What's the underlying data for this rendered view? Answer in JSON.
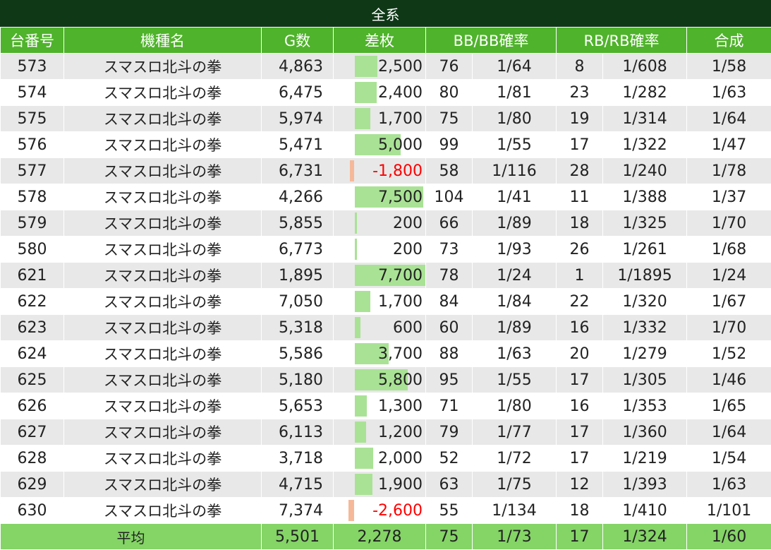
{
  "title": "全系",
  "headers": {
    "unit": "台番号",
    "model": "機種名",
    "games": "G数",
    "diff": "差枚",
    "bb": "BB/BB確率",
    "rb": "RB/RB確率",
    "total": "合成"
  },
  "colors": {
    "title_bg": "#0f3817",
    "header_bg": "#4fb32b",
    "footer_bg": "#84d466",
    "positive_bar": "#a9e295",
    "negative_bar": "#f5b99a",
    "negative_text": "#ff0000"
  },
  "rows": [
    {
      "unit": "573",
      "model": "スマスロ北斗の拳",
      "games": "4,863",
      "diff": "2,500",
      "diff_value": 2500,
      "bb": "76",
      "bb_rate": "1/64",
      "rb": "8",
      "rb_rate": "1/608",
      "total": "1/58"
    },
    {
      "unit": "574",
      "model": "スマスロ北斗の拳",
      "games": "6,475",
      "diff": "2,400",
      "diff_value": 2400,
      "bb": "80",
      "bb_rate": "1/81",
      "rb": "23",
      "rb_rate": "1/282",
      "total": "1/63"
    },
    {
      "unit": "575",
      "model": "スマスロ北斗の拳",
      "games": "5,974",
      "diff": "1,700",
      "diff_value": 1700,
      "bb": "75",
      "bb_rate": "1/80",
      "rb": "19",
      "rb_rate": "1/314",
      "total": "1/64"
    },
    {
      "unit": "576",
      "model": "スマスロ北斗の拳",
      "games": "5,471",
      "diff": "5,000",
      "diff_value": 5000,
      "bb": "99",
      "bb_rate": "1/55",
      "rb": "17",
      "rb_rate": "1/322",
      "total": "1/47"
    },
    {
      "unit": "577",
      "model": "スマスロ北斗の拳",
      "games": "6,731",
      "diff": "-1,800",
      "diff_value": -1800,
      "bb": "58",
      "bb_rate": "1/116",
      "rb": "28",
      "rb_rate": "1/240",
      "total": "1/78"
    },
    {
      "unit": "578",
      "model": "スマスロ北斗の拳",
      "games": "4,266",
      "diff": "7,500",
      "diff_value": 7500,
      "bb": "104",
      "bb_rate": "1/41",
      "rb": "11",
      "rb_rate": "1/388",
      "total": "1/37"
    },
    {
      "unit": "579",
      "model": "スマスロ北斗の拳",
      "games": "5,855",
      "diff": "200",
      "diff_value": 200,
      "bb": "66",
      "bb_rate": "1/89",
      "rb": "18",
      "rb_rate": "1/325",
      "total": "1/70"
    },
    {
      "unit": "580",
      "model": "スマスロ北斗の拳",
      "games": "6,773",
      "diff": "200",
      "diff_value": 200,
      "bb": "73",
      "bb_rate": "1/93",
      "rb": "26",
      "rb_rate": "1/261",
      "total": "1/68"
    },
    {
      "unit": "621",
      "model": "スマスロ北斗の拳",
      "games": "1,895",
      "diff": "7,700",
      "diff_value": 7700,
      "bb": "78",
      "bb_rate": "1/24",
      "rb": "1",
      "rb_rate": "1/1895",
      "total": "1/24"
    },
    {
      "unit": "622",
      "model": "スマスロ北斗の拳",
      "games": "7,050",
      "diff": "1,700",
      "diff_value": 1700,
      "bb": "84",
      "bb_rate": "1/84",
      "rb": "22",
      "rb_rate": "1/320",
      "total": "1/67"
    },
    {
      "unit": "623",
      "model": "スマスロ北斗の拳",
      "games": "5,318",
      "diff": "600",
      "diff_value": 600,
      "bb": "60",
      "bb_rate": "1/89",
      "rb": "16",
      "rb_rate": "1/332",
      "total": "1/70"
    },
    {
      "unit": "624",
      "model": "スマスロ北斗の拳",
      "games": "5,586",
      "diff": "3,700",
      "diff_value": 3700,
      "bb": "88",
      "bb_rate": "1/63",
      "rb": "20",
      "rb_rate": "1/279",
      "total": "1/52"
    },
    {
      "unit": "625",
      "model": "スマスロ北斗の拳",
      "games": "5,180",
      "diff": "5,800",
      "diff_value": 5800,
      "bb": "95",
      "bb_rate": "1/55",
      "rb": "17",
      "rb_rate": "1/305",
      "total": "1/46"
    },
    {
      "unit": "626",
      "model": "スマスロ北斗の拳",
      "games": "5,653",
      "diff": "1,300",
      "diff_value": 1300,
      "bb": "71",
      "bb_rate": "1/80",
      "rb": "16",
      "rb_rate": "1/353",
      "total": "1/65"
    },
    {
      "unit": "627",
      "model": "スマスロ北斗の拳",
      "games": "6,113",
      "diff": "1,200",
      "diff_value": 1200,
      "bb": "79",
      "bb_rate": "1/77",
      "rb": "17",
      "rb_rate": "1/360",
      "total": "1/64"
    },
    {
      "unit": "628",
      "model": "スマスロ北斗の拳",
      "games": "3,718",
      "diff": "2,000",
      "diff_value": 2000,
      "bb": "52",
      "bb_rate": "1/72",
      "rb": "17",
      "rb_rate": "1/219",
      "total": "1/54"
    },
    {
      "unit": "629",
      "model": "スマスロ北斗の拳",
      "games": "4,715",
      "diff": "1,900",
      "diff_value": 1900,
      "bb": "63",
      "bb_rate": "1/75",
      "rb": "12",
      "rb_rate": "1/393",
      "total": "1/63"
    },
    {
      "unit": "630",
      "model": "スマスロ北斗の拳",
      "games": "7,374",
      "diff": "-2,600",
      "diff_value": -2600,
      "bb": "55",
      "bb_rate": "1/134",
      "rb": "18",
      "rb_rate": "1/410",
      "total": "1/101"
    }
  ],
  "average": {
    "label": "平均",
    "games": "5,501",
    "diff": "2,278",
    "bb": "75",
    "bb_rate": "1/73",
    "rb": "17",
    "rb_rate": "1/324",
    "total": "1/60"
  }
}
